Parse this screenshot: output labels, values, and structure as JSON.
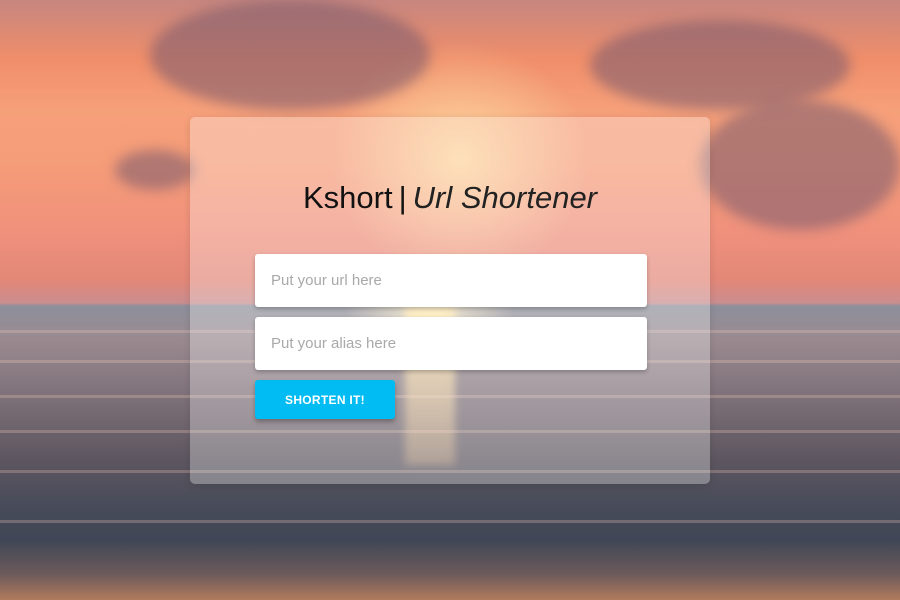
{
  "header": {
    "brand": "Kshort",
    "separator": "|",
    "subtitle": "Url Shortener"
  },
  "form": {
    "url_placeholder": "Put your url here",
    "url_value": "",
    "alias_placeholder": "Put your alias here",
    "alias_value": "",
    "submit_label": "SHORTEN IT!"
  },
  "colors": {
    "accent": "#00bcf2",
    "card_background": "rgba(255,255,255,0.30)"
  }
}
